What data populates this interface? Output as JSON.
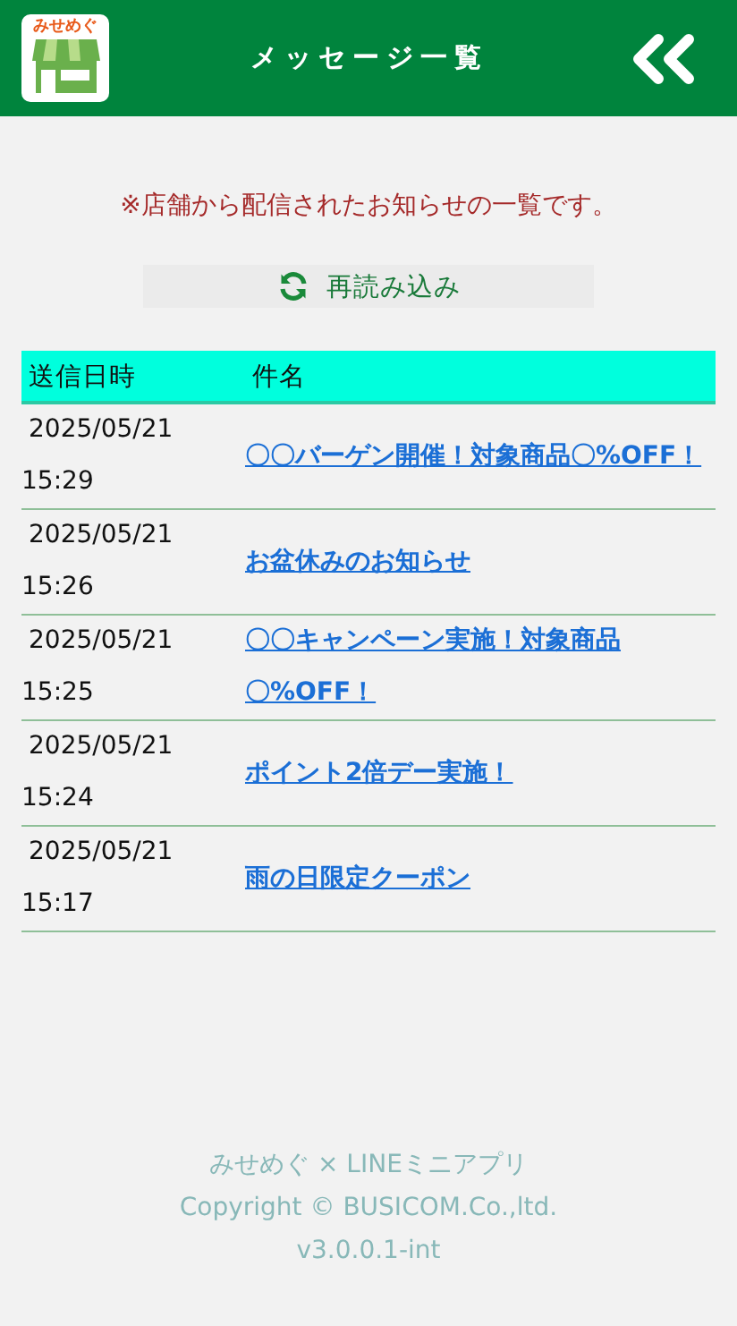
{
  "header": {
    "logo_text": "みせめぐ",
    "title": "メッセージ一覧"
  },
  "notice": "※店舗から配信されたお知らせの一覧です。",
  "reload_button": {
    "label": "再読み込み"
  },
  "table": {
    "columns": [
      "送信日時",
      "件名"
    ],
    "rows": [
      {
        "date": "2025/05/21",
        "time": "15:29",
        "subject": "〇〇バーゲン開催！対象商品〇%OFF！"
      },
      {
        "date": "2025/05/21",
        "time": "15:26",
        "subject": "お盆休みのお知らせ"
      },
      {
        "date": "2025/05/21",
        "time": "15:25",
        "subject": "〇〇キャンペーン実施！対象商品〇%OFF！"
      },
      {
        "date": "2025/05/21",
        "time": "15:24",
        "subject": "ポイント2倍デー実施！"
      },
      {
        "date": "2025/05/21",
        "time": "15:17",
        "subject": "雨の日限定クーポン"
      }
    ]
  },
  "footer": [
    "みせめぐ × LINEミニアプリ",
    "Copyright © BUSICOM.Co.,ltd.",
    "v3.0.0.1-int"
  ]
}
